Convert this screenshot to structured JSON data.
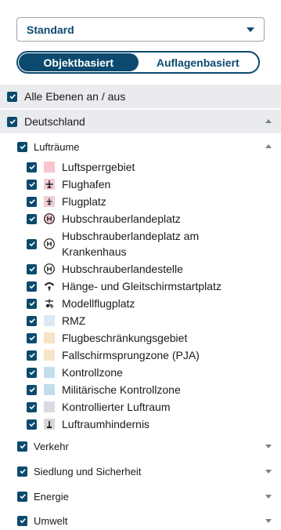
{
  "dropdown": {
    "value": "Standard"
  },
  "segment": {
    "active_label": "Objektbasiert",
    "inactive_label": "Auflagenbasiert"
  },
  "all_layers": {
    "label": "Alle Ebenen an / aus"
  },
  "country": {
    "label": "Deutschland"
  },
  "group_luftraeume": {
    "label": "Lufträume"
  },
  "layers": [
    {
      "label": "Luftsperrgebiet",
      "icon": "swatch-pink-icon",
      "color": "#f7c6cf"
    },
    {
      "label": "Flughafen",
      "icon": "airplane-icon",
      "color": "#f2cdd3"
    },
    {
      "label": "Flugplatz",
      "icon": "small-airplane-icon",
      "color": "#f2cdd3"
    },
    {
      "label": "Hubschrauberlandeplatz",
      "icon": "helipad-icon",
      "color": "#f2cdd3"
    },
    {
      "label_line1": "Hubschrauberlandeplatz am",
      "label_line2": "Krankenhaus",
      "icon": "hospital-helipad-icon"
    },
    {
      "label": "Hubschrauberlandestelle",
      "icon": "heli-landing-site-icon"
    },
    {
      "label": "Hänge- und Gleitschirmstartplatz",
      "icon": "paraglider-icon"
    },
    {
      "label": "Modellflugplatz",
      "icon": "model-aircraft-icon"
    },
    {
      "label": "RMZ",
      "icon": "swatch-lightblue-icon",
      "color": "#dbe9f5"
    },
    {
      "label": "Flugbeschränkungsgebiet",
      "icon": "swatch-beige-icon",
      "color": "#f8e3c6"
    },
    {
      "label": "Fallschirmsprungzone (PJA)",
      "icon": "swatch-beige-icon",
      "color": "#f8e3c6"
    },
    {
      "label": "Kontrollzone",
      "icon": "swatch-blue-icon",
      "color": "#c3dcee"
    },
    {
      "label": "Militärische Kontrollzone",
      "icon": "swatch-blue-icon",
      "color": "#c3dcee"
    },
    {
      "label": "Kontrollierter Luftraum",
      "icon": "swatch-grey-icon",
      "color": "#d9dbe2"
    },
    {
      "label": "Luftraumhindernis",
      "icon": "obstacle-icon",
      "color": "#d6d6d6"
    }
  ],
  "groups": [
    {
      "label": "Verkehr"
    },
    {
      "label": "Siedlung und Sicherheit"
    },
    {
      "label": "Energie"
    },
    {
      "label": "Umwelt"
    }
  ],
  "colors": {
    "accent": "#0b4a6e",
    "band": "#e9ebee"
  }
}
